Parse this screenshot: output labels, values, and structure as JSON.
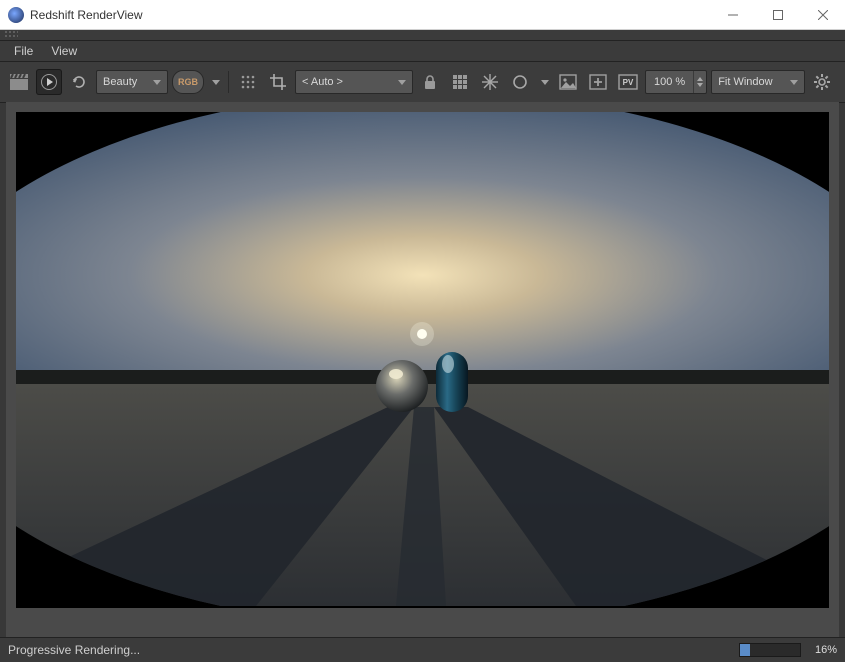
{
  "window": {
    "title": "Redshift RenderView"
  },
  "menu": {
    "file": "File",
    "view": "View"
  },
  "toolbar": {
    "aov_dropdown": "Beauty",
    "rgb_pill": "RGB",
    "region_dropdown": "< Auto >",
    "zoom_value": "100 %",
    "fit_dropdown": "Fit Window",
    "pv_label": "PV"
  },
  "status": {
    "text": "Progressive Rendering...",
    "percent_label": "16%",
    "percent_value": 16
  }
}
